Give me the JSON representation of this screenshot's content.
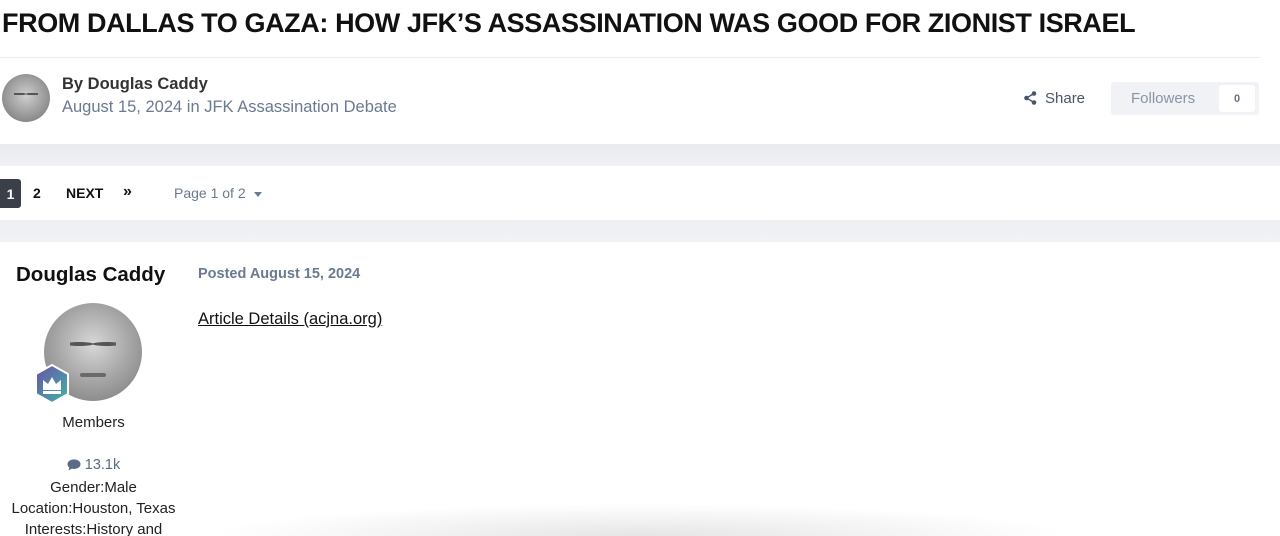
{
  "topic": {
    "title": "FROM DALLAS TO GAZA: HOW JFK’S ASSASSINATION WAS GOOD FOR ZIONIST ISRAEL",
    "author_line": "By Douglas Caddy",
    "date": "August 15, 2024",
    "in_word": "in",
    "category": "JFK Assassination Debate"
  },
  "actions": {
    "share_label": "Share",
    "followers_label": "Followers",
    "followers_count": "0"
  },
  "pagination": {
    "active_page": "1",
    "page2": "2",
    "next_label": "NEXT",
    "last_glyph": "»",
    "page_select": "Page 1 of 2"
  },
  "post": {
    "author_name": "Douglas Caddy",
    "posted_label": "Posted August 15, 2024",
    "link_text": "Article Details (acjna.org)",
    "group": "Members",
    "post_count": "13.1k",
    "gender": "Gender:Male",
    "location": "Location:Houston, Texas",
    "interests": "Interests:History and"
  },
  "colors": {
    "accent_dark": "#3b3f47",
    "muted_text": "#6b7a90",
    "badge_purple": "#6b4fa8",
    "badge_teal": "#3fb7a6"
  },
  "icons": {
    "share": "share-icon",
    "posts": "speech-bubble-icon",
    "badge": "crown-badge-icon"
  }
}
